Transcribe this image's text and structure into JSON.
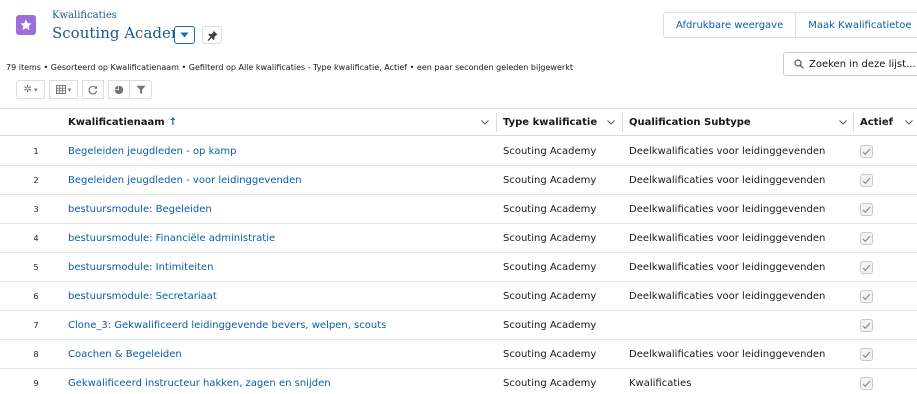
{
  "header": {
    "object_label": "Kwalificaties",
    "list_title": "Scouting Academy",
    "icon_color": "#9b6fd6"
  },
  "actions": {
    "printable": "Afdrukbare weergave",
    "create": "Maak Kwalificatietoe"
  },
  "meta": "79 items • Gesorteerd op Kwalificatienaam • Gefilterd op Alle kwalificaties - Type kwalificatie, Actief • een paar seconden geleden bijgewerkt",
  "search": {
    "placeholder": "Zoeken in deze lijst..."
  },
  "columns": {
    "name": "Kwalificatienaam",
    "type": "Type kwalificatie",
    "subtype": "Qualification Subtype",
    "active": "Actief"
  },
  "rows": [
    {
      "num": "1",
      "name": "Begeleiden jeugdleden - op kamp",
      "type": "Scouting Academy",
      "subtype": "Deelkwalificaties voor leidinggevenden",
      "active": true
    },
    {
      "num": "2",
      "name": "Begeleiden jeugdleden - voor leidinggevenden",
      "type": "Scouting Academy",
      "subtype": "Deelkwalificaties voor leidinggevenden",
      "active": true
    },
    {
      "num": "3",
      "name": "bestuursmodule: Begeleiden",
      "type": "Scouting Academy",
      "subtype": "Deelkwalificaties voor leidinggevenden",
      "active": true
    },
    {
      "num": "4",
      "name": "bestuursmodule: Financiële administratie",
      "type": "Scouting Academy",
      "subtype": "Deelkwalificaties voor leidinggevenden",
      "active": true
    },
    {
      "num": "5",
      "name": "bestuursmodule: Intimiteiten",
      "type": "Scouting Academy",
      "subtype": "Deelkwalificaties voor leidinggevenden",
      "active": true
    },
    {
      "num": "6",
      "name": "bestuursmodule: Secretariaat",
      "type": "Scouting Academy",
      "subtype": "Deelkwalificaties voor leidinggevenden",
      "active": true
    },
    {
      "num": "7",
      "name": "Clone_3: Gekwalificeerd leidinggevende bevers, welpen, scouts",
      "type": "Scouting Academy",
      "subtype": "",
      "active": true
    },
    {
      "num": "8",
      "name": "Coachen & Begeleiden",
      "type": "Scouting Academy",
      "subtype": "Deelkwalificaties voor leidinggevenden",
      "active": true
    },
    {
      "num": "9",
      "name": "Gekwalificeerd instructeur hakken, zagen en snijden",
      "type": "Scouting Academy",
      "subtype": "Kwalificaties",
      "active": true
    }
  ]
}
